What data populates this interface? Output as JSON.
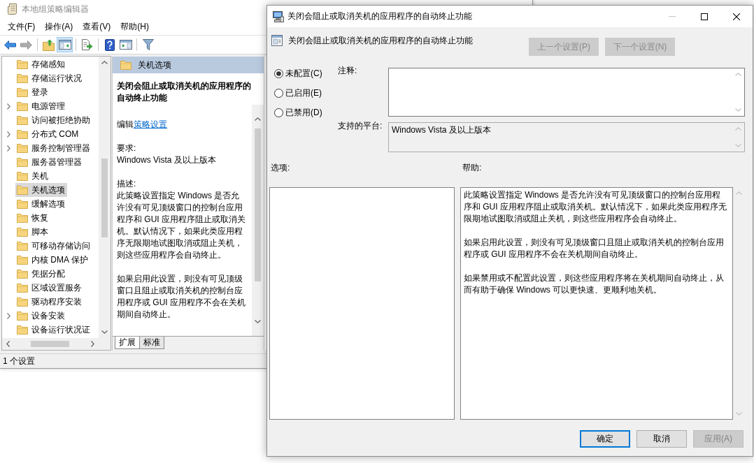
{
  "main_window": {
    "title": "本地组策略编辑器",
    "menu": [
      "文件(F)",
      "操作(A)",
      "查看(V)",
      "帮助(H)"
    ],
    "toolbar": [
      [
        {
          "kind": "back",
          "on": false,
          "disabled": false
        },
        {
          "kind": "forward",
          "on": false,
          "disabled": true
        }
      ],
      [
        {
          "kind": "up",
          "on": false,
          "disabled": false
        },
        {
          "kind": "tree",
          "on": true,
          "disabled": false
        }
      ],
      [
        {
          "kind": "export",
          "on": false,
          "disabled": false
        }
      ],
      [
        {
          "kind": "help",
          "on": false,
          "disabled": false
        },
        {
          "kind": "panel",
          "on": false,
          "disabled": false
        }
      ],
      [
        {
          "kind": "filter",
          "on": false,
          "disabled": false
        }
      ]
    ],
    "tree": {
      "items": [
        {
          "label": "存储感知",
          "has_children": false,
          "selected": false
        },
        {
          "label": "存储运行状况",
          "has_children": false,
          "selected": false
        },
        {
          "label": "登录",
          "has_children": false,
          "selected": false
        },
        {
          "label": "电源管理",
          "has_children": true,
          "selected": false
        },
        {
          "label": "访问被拒绝协助",
          "has_children": false,
          "selected": false
        },
        {
          "label": "分布式 COM",
          "has_children": true,
          "selected": false
        },
        {
          "label": "服务控制管理器",
          "has_children": true,
          "selected": false
        },
        {
          "label": "服务器管理器",
          "has_children": false,
          "selected": false
        },
        {
          "label": "关机",
          "has_children": false,
          "selected": false
        },
        {
          "label": "关机选项",
          "has_children": false,
          "selected": true
        },
        {
          "label": "缓解选项",
          "has_children": false,
          "selected": false
        },
        {
          "label": "恢复",
          "has_children": false,
          "selected": false
        },
        {
          "label": "脚本",
          "has_children": false,
          "selected": false
        },
        {
          "label": "可移动存储访问",
          "has_children": false,
          "selected": false
        },
        {
          "label": "内核 DMA 保护",
          "has_children": false,
          "selected": false
        },
        {
          "label": "凭据分配",
          "has_children": false,
          "selected": false
        },
        {
          "label": "区域设置服务",
          "has_children": false,
          "selected": false
        },
        {
          "label": "驱动程序安装",
          "has_children": false,
          "selected": false
        },
        {
          "label": "设备安装",
          "has_children": true,
          "selected": false
        },
        {
          "label": "设备运行状况证",
          "has_children": false,
          "selected": false
        }
      ]
    },
    "details": {
      "header": "关机选项",
      "title": "关闭会阻止或取消关机的应用程序的自动终止功能",
      "edit_prefix": "编辑",
      "edit_link": "策略设置",
      "requirements_label": "要求:",
      "requirements": "Windows Vista 及以上版本",
      "description_label": "描述:",
      "description": [
        "此策略设置指定 Windows 是否允许没有可见顶级窗口的控制台应用程序和 GUI 应用程序阻止或取消关机。默认情况下，如果此类应用程序无限期地试图取消或阻止关机，则这些应用程序会自动终止。",
        "如果启用此设置，则没有可见顶级窗口且阻止或取消关机的控制台应用程序或 GUI 应用程序不会在关机期间自动终止。"
      ],
      "tabs": [
        {
          "label": "扩展",
          "selected": true
        },
        {
          "label": "标准",
          "selected": false
        }
      ]
    },
    "status_bar": "1 个设置"
  },
  "dialog": {
    "title": "关闭会阻止或取消关机的应用程序的自动终止功能",
    "window_buttons": [
      {
        "kind": "minimize",
        "disabled": true
      },
      {
        "kind": "maximize",
        "disabled": false
      },
      {
        "kind": "close",
        "disabled": false
      }
    ],
    "heading": "关闭会阻止或取消关机的应用程序的自动终止功能",
    "nav_buttons": [
      {
        "label": "上一个设置(P)",
        "disabled": true
      },
      {
        "label": "下一个设置(N)",
        "disabled": true
      }
    ],
    "states": [
      {
        "label": "未配置(C)",
        "selected": true
      },
      {
        "label": "已启用(E)",
        "selected": false
      },
      {
        "label": "已禁用(D)",
        "selected": false
      }
    ],
    "comment_label": "注释:",
    "platform_label": "支持的平台:",
    "platform": "Windows Vista 及以上版本",
    "options_label": "选项:",
    "help_label": "帮助:",
    "help": [
      "此策略设置指定 Windows 是否允许没有可见顶级窗口的控制台应用程序和 GUI 应用程序阻止或取消关机。默认情况下，如果此类应用程序无限期地试图取消或阻止关机，则这些应用程序会自动终止。",
      "如果启用此设置，则没有可见顶级窗口且阻止或取消关机的控制台应用程序或 GUI 应用程序不会在关机期间自动终止。",
      "如果禁用或不配置此设置，则这些应用程序将在关机期间自动终止，从而有助于确保 Windows 可以更快速、更顺利地关机。"
    ],
    "buttons": [
      {
        "label": "确定",
        "default": true,
        "disabled": false
      },
      {
        "label": "取消",
        "default": false,
        "disabled": false
      },
      {
        "label": "应用(A)",
        "default": false,
        "disabled": true
      }
    ]
  }
}
